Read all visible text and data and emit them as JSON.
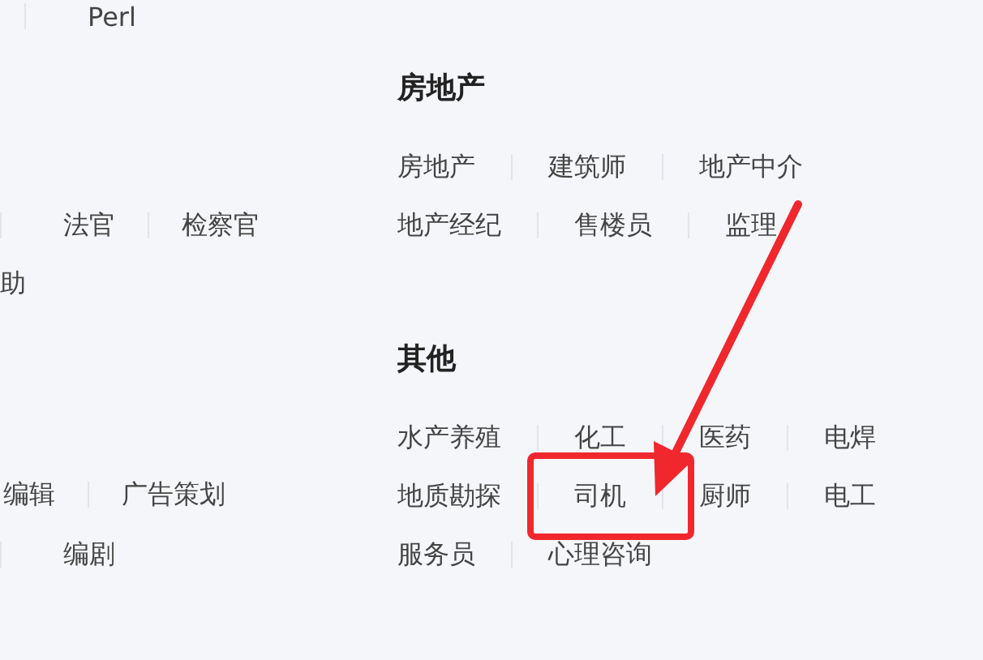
{
  "left_column": {
    "rows": [
      {
        "leading_divider": true,
        "items": [
          {
            "label": "Perl"
          }
        ]
      },
      {
        "leading_divider": true,
        "items": [
          {
            "label": "法官"
          },
          {
            "label": "检察官"
          }
        ]
      },
      {
        "leading_divider": false,
        "items": [
          {
            "label": "助"
          }
        ]
      },
      {
        "leading_divider": false,
        "items": [
          {
            "label": "编辑"
          },
          {
            "label": "广告策划"
          }
        ]
      },
      {
        "leading_divider": true,
        "items": [
          {
            "label": "编剧"
          }
        ]
      }
    ]
  },
  "sections": [
    {
      "title": "房地产",
      "rows": [
        [
          {
            "label": "房地产",
            "highlighted": false
          },
          {
            "label": "建筑师",
            "highlighted": false
          },
          {
            "label": "地产中介",
            "highlighted": false
          }
        ],
        [
          {
            "label": "地产经纪",
            "highlighted": false
          },
          {
            "label": "售楼员",
            "highlighted": false
          },
          {
            "label": "监理",
            "highlighted": false
          }
        ]
      ]
    },
    {
      "title": "其他",
      "rows": [
        [
          {
            "label": "水产养殖",
            "highlighted": false
          },
          {
            "label": "化工",
            "highlighted": false
          },
          {
            "label": "医药",
            "highlighted": false
          },
          {
            "label": "电焊",
            "highlighted": false
          }
        ],
        [
          {
            "label": "地质勘探",
            "highlighted": false
          },
          {
            "label": "司机",
            "highlighted": true
          },
          {
            "label": "厨师",
            "highlighted": false
          },
          {
            "label": "电工",
            "highlighted": false
          }
        ],
        [
          {
            "label": "服务员",
            "highlighted": false
          },
          {
            "label": "心理咨询",
            "highlighted": false
          }
        ]
      ]
    }
  ]
}
